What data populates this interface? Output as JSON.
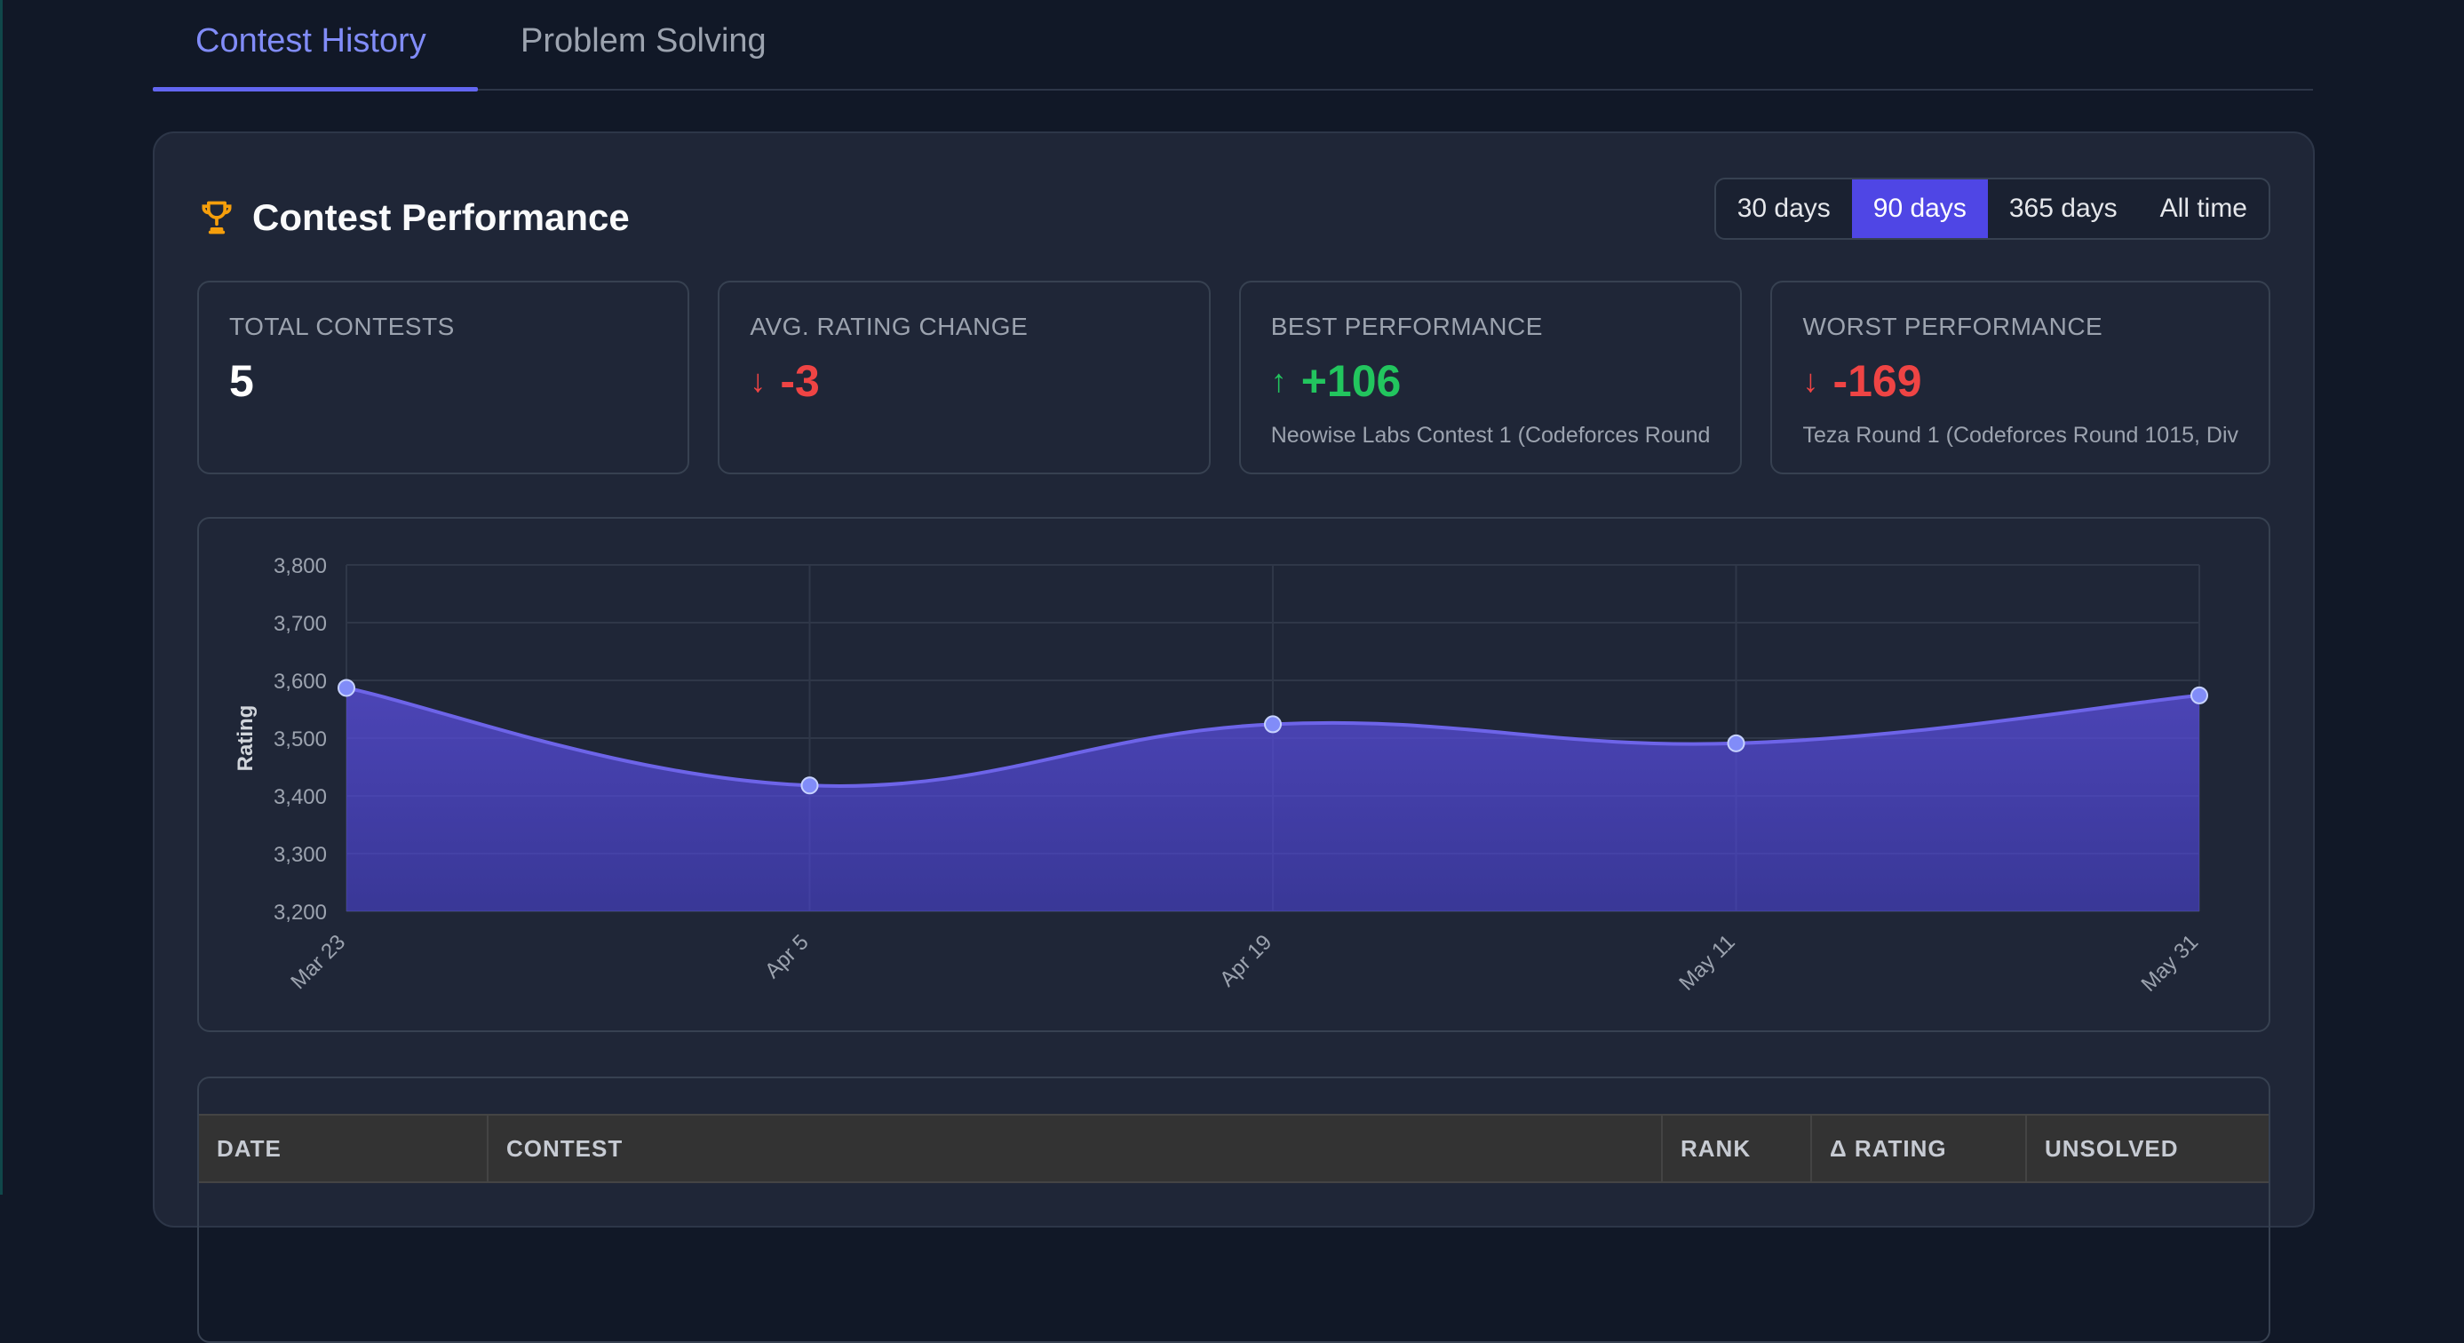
{
  "tabs": [
    {
      "label": "Contest History",
      "active": true
    },
    {
      "label": "Problem Solving",
      "active": false
    }
  ],
  "panel": {
    "icon": "trophy-icon",
    "title": "Contest Performance",
    "ranges": [
      {
        "label": "30 days",
        "active": false
      },
      {
        "label": "90 days",
        "active": true
      },
      {
        "label": "365 days",
        "active": false
      },
      {
        "label": "All time",
        "active": false
      }
    ]
  },
  "stats": [
    {
      "label": "TOTAL CONTESTS",
      "value": "5",
      "arrow": "",
      "sub": ""
    },
    {
      "label": "AVG. RATING CHANGE",
      "value": "-3",
      "arrow": "↓",
      "sub": ""
    },
    {
      "label": "BEST PERFORMANCE",
      "value": "+106",
      "arrow": "↑",
      "sub": "Neowise Labs Contest 1 (Codeforces Round"
    },
    {
      "label": "WORST PERFORMANCE",
      "value": "-169",
      "arrow": "↓",
      "sub": "Teza Round 1 (Codeforces Round 1015, Div"
    }
  ],
  "colors": {
    "accent": "#6366f1",
    "active_range": "#4f46e5",
    "positive": "#22c55e",
    "negative": "#ef4444",
    "trophy": "#f59e0b"
  },
  "chart_data": {
    "type": "area",
    "ylabel": "Rating",
    "xlabel": "",
    "title": "",
    "categories": [
      "Mar 23",
      "Apr 5",
      "Apr 19",
      "May 11",
      "May 31"
    ],
    "series": [
      {
        "values": [
          3587,
          3418,
          3524,
          3491,
          3574
        ]
      }
    ],
    "ylim": [
      3200,
      3800
    ],
    "yticks": [
      3200,
      3300,
      3400,
      3500,
      3600,
      3700,
      3800
    ],
    "ytick_labels": [
      "3,200",
      "3,300",
      "3,400",
      "3,500",
      "3,600",
      "3,700",
      "3,800"
    ],
    "grid": true
  },
  "table": {
    "columns": [
      "DATE",
      "CONTEST",
      "RANK",
      "Δ RATING",
      "UNSOLVED"
    ]
  }
}
